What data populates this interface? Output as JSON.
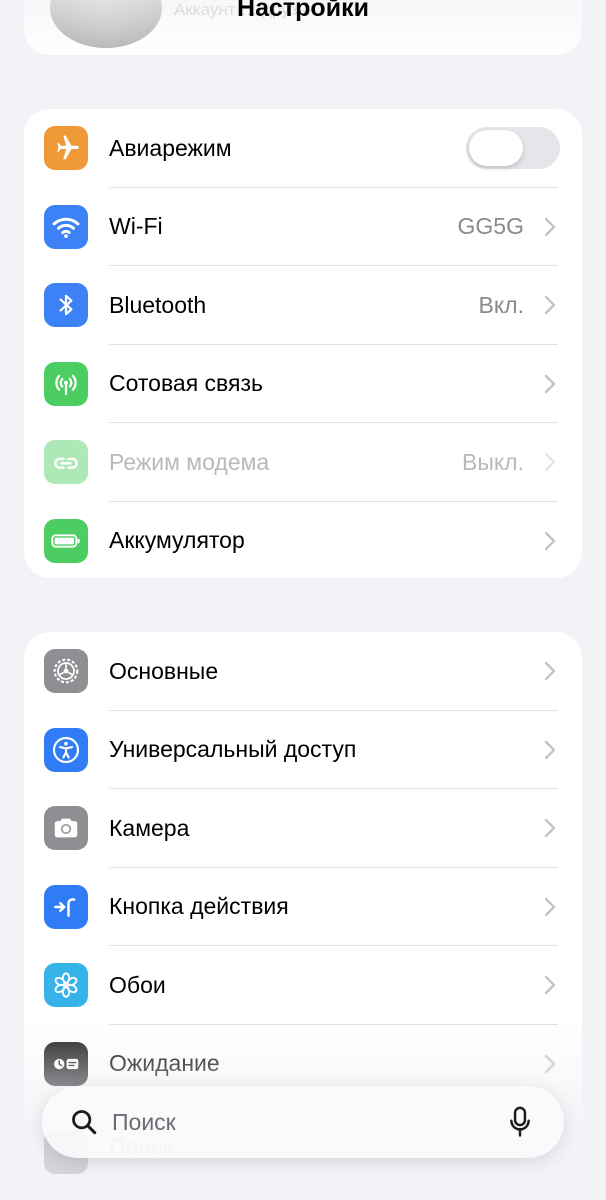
{
  "header": {
    "title": "Настройки",
    "profile_subtitle": "Аккаунт … друзья"
  },
  "group1": [
    {
      "label": "Авиарежим",
      "icon": "airplane-icon",
      "color": "#f09a37",
      "toggle": true,
      "toggle_on": false
    },
    {
      "label": "Wi-Fi",
      "icon": "wifi-icon",
      "color": "#3c82f6",
      "value": "GG5G"
    },
    {
      "label": "Bluetooth",
      "icon": "bluetooth-icon",
      "color": "#3c82f6",
      "value": "Вкл."
    },
    {
      "label": "Сотовая связь",
      "icon": "cellular-icon",
      "color": "#4ccd62"
    },
    {
      "label": "Режим модема",
      "icon": "hotspot-icon",
      "color": "#4ccd62",
      "value": "Выкл.",
      "disabled": true
    },
    {
      "label": "Аккумулятор",
      "icon": "battery-icon",
      "color": "#4ccd62"
    }
  ],
  "group2": [
    {
      "label": "Основные",
      "icon": "gear-icon",
      "color": "#8e8e93"
    },
    {
      "label": "Универсальный доступ",
      "icon": "accessibility-icon",
      "color": "#2f7cf6"
    },
    {
      "label": "Камера",
      "icon": "camera-icon",
      "color": "#8e8e93"
    },
    {
      "label": "Кнопка действия",
      "icon": "action-button-icon",
      "color": "#2f7cf6"
    },
    {
      "label": "Обои",
      "icon": "wallpaper-icon",
      "color": "#36b4ea"
    },
    {
      "label": "Ожидание",
      "icon": "standby-icon",
      "color": "#1c1c1e"
    }
  ],
  "search": {
    "placeholder": "Поиск",
    "ghost_label": "Поиск"
  }
}
